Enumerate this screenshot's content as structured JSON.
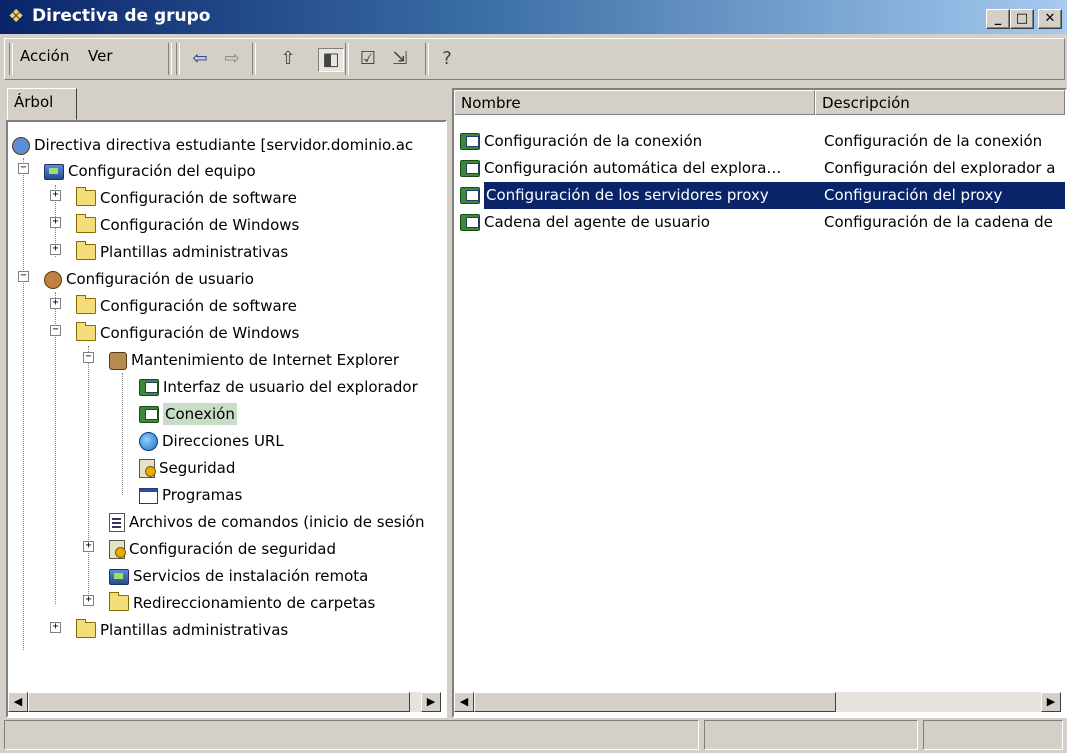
{
  "window": {
    "title": "Directiva de grupo",
    "controls": [
      "_",
      "□",
      "✕"
    ]
  },
  "menu": {
    "action_label": "Acción",
    "view_label": "Ver"
  },
  "toolbar_icons": [
    "back-arrow-icon",
    "forward-arrow-icon",
    "up-folder-icon",
    "show-tree-icon",
    "properties-icon",
    "export-list-icon",
    "help-icon"
  ],
  "left_pane": {
    "tab_label": "Árbol",
    "tree": [
      {
        "label": "Directiva directiva estudiante [servidor.dominio.ac",
        "icon": "policy-icon"
      },
      {
        "label": "Configuración del equipo",
        "icon": "computer-icon",
        "expander": "-"
      },
      {
        "label": "Configuración de software",
        "icon": "folder-icon",
        "expander": "+"
      },
      {
        "label": "Configuración de Windows",
        "icon": "folder-icon",
        "expander": "+"
      },
      {
        "label": "Plantillas administrativas",
        "icon": "folder-icon",
        "expander": "+"
      },
      {
        "label": "Configuración de usuario",
        "icon": "user-icon",
        "expander": "-"
      },
      {
        "label": "Configuración de software",
        "icon": "folder-icon",
        "expander": "+"
      },
      {
        "label": "Configuración de Windows",
        "icon": "folder-icon",
        "expander": "-"
      },
      {
        "label": "Mantenimiento de Internet Explorer",
        "icon": "ie-maintenance-icon",
        "expander": "-"
      },
      {
        "label": "Interfaz de usuario del explorador",
        "icon": "browser-ui-icon"
      },
      {
        "label": "Conexión",
        "icon": "connection-icon"
      },
      {
        "label": "Direcciones URL",
        "icon": "globe-icon"
      },
      {
        "label": "Seguridad",
        "icon": "security-icon"
      },
      {
        "label": "Programas",
        "icon": "programs-icon"
      },
      {
        "label": "Archivos de comandos (inicio de sesión",
        "icon": "script-icon"
      },
      {
        "label": "Configuración de seguridad",
        "icon": "security-settings-icon",
        "expander": "+"
      },
      {
        "label": "Servicios de instalación remota",
        "icon": "remote-install-icon"
      },
      {
        "label": "Redireccionamiento de carpetas",
        "icon": "folder-icon",
        "expander": "+"
      },
      {
        "label": "Plantillas administrativas",
        "icon": "folder-icon",
        "expander": "+"
      }
    ]
  },
  "right_pane": {
    "columns": [
      "Nombre",
      "Descripción"
    ],
    "rows": [
      {
        "name": "Configuración de la conexión",
        "description": "Configuración de la conexión"
      },
      {
        "name": "Configuración automática del explora…",
        "description": "Configuración del explorador a"
      },
      {
        "name": "Configuración de los servidores proxy",
        "description": "Configuración del proxy"
      },
      {
        "name": "Cadena del agente de usuario",
        "description": "Configuración de la cadena de"
      }
    ],
    "selected_row": 3
  },
  "status_bar": [
    "",
    "",
    ""
  ]
}
